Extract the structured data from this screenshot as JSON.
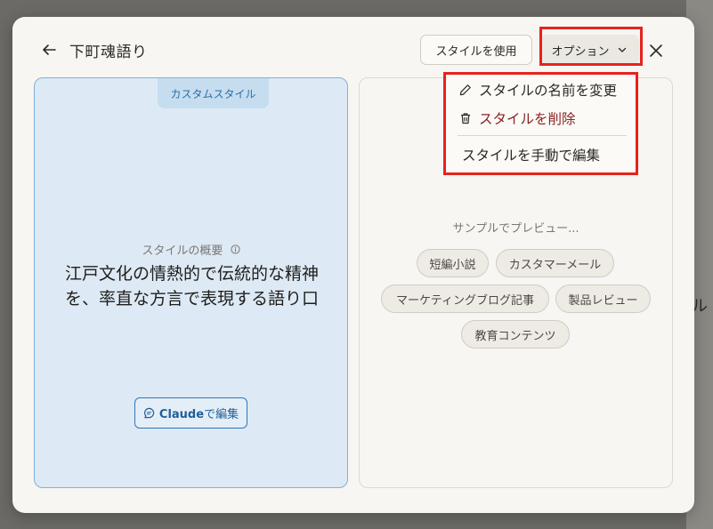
{
  "header": {
    "title": "下町魂語り",
    "use_button": "スタイルを使用",
    "options_button": "オプション"
  },
  "left_card": {
    "badge": "カスタムスタイル",
    "summary_label": "スタイルの概要",
    "summary_text": "江戸文化の情熱的で伝統的な精神を、率直な方言で表現する語り口",
    "edit_button_bold": "Claude",
    "edit_button_rest": "で編集"
  },
  "right_card": {
    "preview_label": "サンプルでプレビュー...",
    "chips": [
      "短編小説",
      "カスタマーメール",
      "マーケティングブログ記事",
      "製品レビュー",
      "教育コンテンツ"
    ]
  },
  "options_menu": {
    "items": [
      {
        "label": "スタイルの名前を変更",
        "icon": "pencil-icon"
      },
      {
        "label": "スタイルを削除",
        "icon": "trash-icon",
        "danger": true
      },
      {
        "label": "スタイルを手動で編集"
      }
    ]
  },
  "background": {
    "fragment_a": "ル"
  },
  "colors": {
    "accent_blue": "#2f78b8",
    "highlight_red": "#e5231c",
    "danger": "#8a2323"
  }
}
